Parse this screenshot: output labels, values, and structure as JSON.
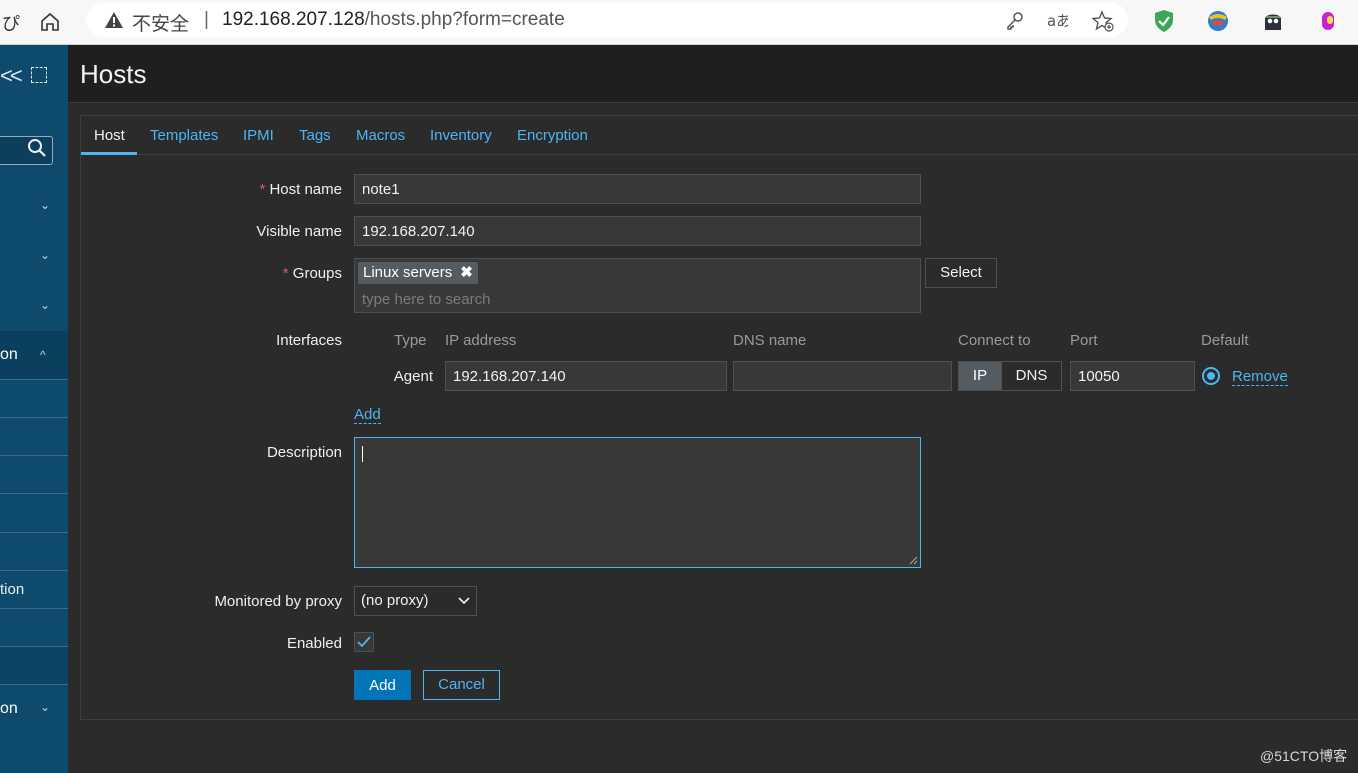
{
  "browser": {
    "back_glyph": "ぴ",
    "security_label": "不安全",
    "separator": "|",
    "url_host": "192.168.207.128",
    "url_path": "/hosts.php?form=create"
  },
  "sidebar": {
    "active_item_fragment": "on",
    "sub_item_fragment": "tion",
    "bottom_item_fragment": "on"
  },
  "page": {
    "title": "Hosts"
  },
  "tabs": [
    "Host",
    "Templates",
    "IPMI",
    "Tags",
    "Macros",
    "Inventory",
    "Encryption"
  ],
  "form": {
    "host_name_label": "Host name",
    "host_name_value": "note1",
    "visible_name_label": "Visible name",
    "visible_name_value": "192.168.207.140",
    "groups_label": "Groups",
    "group_chip": "Linux servers",
    "groups_placeholder": "type here to search",
    "select_button": "Select",
    "interfaces_label": "Interfaces",
    "interface_headers": {
      "type": "Type",
      "ip": "IP address",
      "dns": "DNS name",
      "connect": "Connect to",
      "port": "Port",
      "default": "Default"
    },
    "interface_row": {
      "type": "Agent",
      "ip": "192.168.207.140",
      "dns": "",
      "connect_ip": "IP",
      "connect_dns": "DNS",
      "port": "10050",
      "remove": "Remove"
    },
    "add_interface_link": "Add",
    "description_label": "Description",
    "proxy_label": "Monitored by proxy",
    "proxy_value": "(no proxy)",
    "enabled_label": "Enabled",
    "add_button": "Add",
    "cancel_button": "Cancel"
  },
  "watermark": "@51CTO博客",
  "colors": {
    "accent": "#4db5f5",
    "primary_button": "#0275b8",
    "sidebar": "#0e4a6b",
    "required": "#e45959"
  },
  "icons": [
    "home-icon",
    "warning-icon",
    "key-icon",
    "read-aloud-icon",
    "favorites-icon",
    "shield-extension-icon",
    "colorful-extension-icon",
    "ghost-extension-icon",
    "purple-extension-icon",
    "collapse-sidebar-icon",
    "expand-icon",
    "search-icon",
    "chevron-down-icon",
    "chevron-up-icon",
    "checkmark-icon"
  ]
}
